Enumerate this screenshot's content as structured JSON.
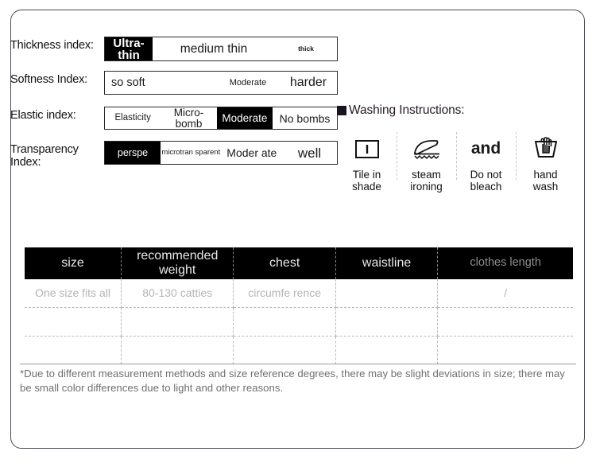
{
  "indexes": [
    {
      "name": "thickness",
      "label": "Thickness index:",
      "segments": [
        {
          "text": "Ultra-\nthin",
          "selected": true
        },
        {
          "text": "medium thin",
          "selected": false
        },
        {
          "text": "thick",
          "selected": false
        }
      ]
    },
    {
      "name": "softness",
      "label": "Softness Index:",
      "segments": [
        {
          "text": "so\nsoft",
          "selected": false
        },
        {
          "text": "",
          "selected": false
        },
        {
          "text": "Moderate",
          "selected": false
        },
        {
          "text": "harder",
          "selected": false
        }
      ]
    },
    {
      "name": "elastic",
      "label": "Elastic index:",
      "segments": [
        {
          "text": "Elasticity",
          "selected": false
        },
        {
          "text": "Micro-\nbomb",
          "selected": false
        },
        {
          "text": "Moderate",
          "selected": true
        },
        {
          "text": "No bombs",
          "selected": false
        }
      ]
    },
    {
      "name": "transparency",
      "label": "Transparency\nIndex:",
      "segments": [
        {
          "text": "perspe",
          "selected": true
        },
        {
          "text": "microtran\nsparent",
          "selected": false
        },
        {
          "text": "Moder\nate",
          "selected": false
        },
        {
          "text": "well",
          "selected": false
        }
      ]
    }
  ],
  "washing": {
    "title": "Washing Instructions:",
    "items": [
      {
        "icon": "drip-dry-in-shade-icon",
        "caption": "Tile in\nshade"
      },
      {
        "icon": "steam-iron-icon",
        "caption": "steam\nironing"
      },
      {
        "icon": "do-not-bleach-icon",
        "caption": "Do not\nbleach",
        "glyph_text": "and"
      },
      {
        "icon": "hand-wash-icon",
        "caption": "hand\nwash"
      }
    ]
  },
  "size_table": {
    "headers": [
      "size",
      "recommended\nweight",
      "chest",
      "waistline",
      "clothes\nlength"
    ],
    "rows": [
      [
        "One size\nfits all",
        "80-130 catties",
        "circumfe\nrence",
        "",
        "/"
      ],
      [
        "",
        "",
        "",
        "",
        ""
      ],
      [
        "",
        "",
        "",
        "",
        ""
      ]
    ]
  },
  "note": "*Due to different measurement methods and size reference degrees, there may be slight deviations in size; there may be small color differences due to light and other reasons.",
  "colors": {
    "selected_bg": "#000000",
    "header_bg": "#000000",
    "border": "#4a4a52",
    "faded_text": "#b4b4b4"
  }
}
